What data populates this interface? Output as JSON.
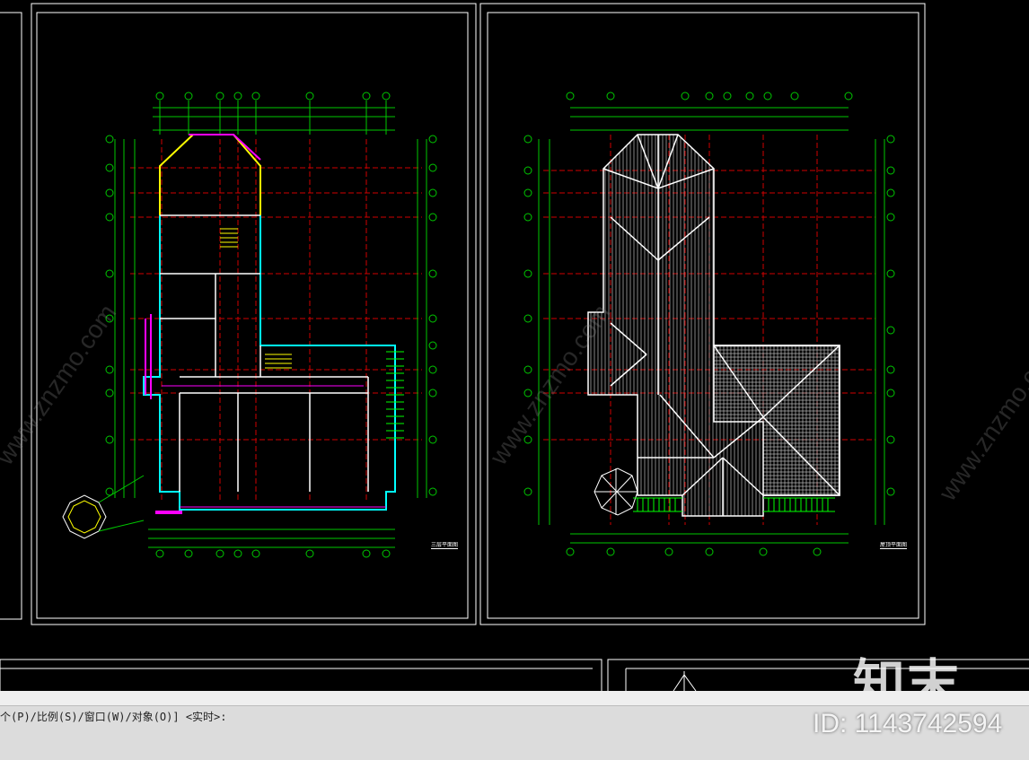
{
  "command_line": {
    "prompt": "个(P)/比例(S)/窗口(W)/对象(O)] <实时>:"
  },
  "sheets": {
    "left_title": "三层平面图",
    "right_title": "屋顶平面图"
  },
  "watermark": {
    "logo": "知末",
    "id": "ID: 1143742594",
    "site": "www.znzmo.com",
    "cn": "知末网"
  },
  "colors": {
    "background": "#000000",
    "axis_green": "#00c800",
    "grid_red": "#d00000",
    "wall_white": "#ffffff",
    "cyan": "#00ffff",
    "magenta": "#ff00ff",
    "yellow": "#ffff00",
    "command_bar": "#dcdcdc"
  }
}
